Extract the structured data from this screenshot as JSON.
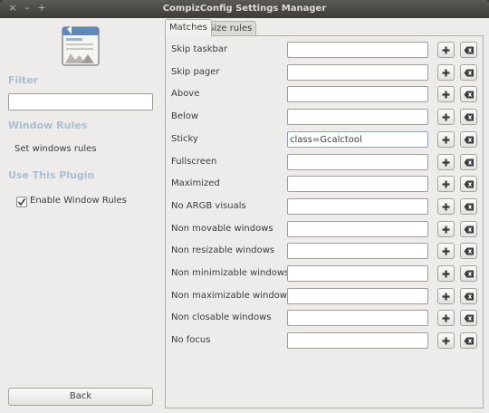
{
  "window": {
    "title": "CompizConfig Settings Manager"
  },
  "window_buttons": {
    "close": "×",
    "minimize": "–",
    "maximize": "+"
  },
  "sidebar": {
    "filter_heading": "Filter",
    "filter_value": "",
    "window_rules_heading": "Window Rules",
    "set_rules_label": "Set windows rules",
    "use_plugin_heading": "Use This Plugin",
    "enable_label": "Enable Window Rules",
    "enable_checked": true,
    "back_label": "Back"
  },
  "tabs": [
    {
      "label": "Matches",
      "active": true
    },
    {
      "label": "Size rules",
      "active": false
    }
  ],
  "matches": [
    {
      "label": "Skip taskbar",
      "value": ""
    },
    {
      "label": "Skip pager",
      "value": ""
    },
    {
      "label": "Above",
      "value": ""
    },
    {
      "label": "Below",
      "value": ""
    },
    {
      "label": "Sticky",
      "value": "class=Gcalctool"
    },
    {
      "label": "Fullscreen",
      "value": ""
    },
    {
      "label": "Maximized",
      "value": ""
    },
    {
      "label": "No ARGB visuals",
      "value": ""
    },
    {
      "label": "Non movable windows",
      "value": ""
    },
    {
      "label": "Non resizable windows",
      "value": ""
    },
    {
      "label": "Non minimizable windows",
      "value": ""
    },
    {
      "label": "Non maximizable windows",
      "value": ""
    },
    {
      "label": "Non closable windows",
      "value": ""
    },
    {
      "label": "No focus",
      "value": ""
    }
  ],
  "icons": {
    "add": "plus-icon",
    "clear": "backspace-clear-icon",
    "plugin": "window-rules-plugin-icon"
  },
  "colors": {
    "section_heading": "#a9bfd4",
    "focus_border": "#7fa6d2",
    "titlebar": "#3d3c38"
  }
}
